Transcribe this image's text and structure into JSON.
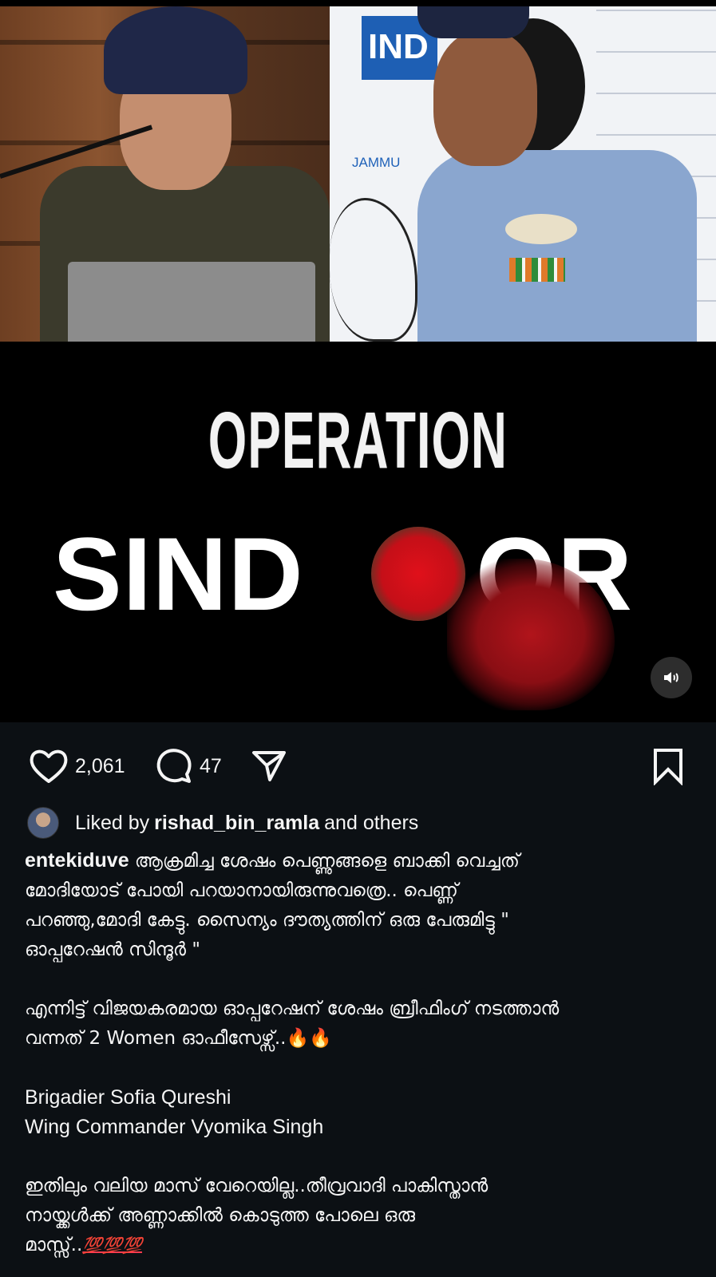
{
  "media": {
    "map_label_ind": "IND",
    "map_label_jammu": "JAMMU",
    "title_line1": "OPERATION",
    "title_sind": "SIND",
    "title_or": "OR"
  },
  "actions": {
    "likes_count": "2,061",
    "comments_count": "47"
  },
  "liked_by": {
    "prefix": "Liked by",
    "user": "rishad_bin_ramla",
    "suffix": "and others"
  },
  "caption": {
    "username": "entekiduve",
    "line1": "ആക്രമിച്ച ശേഷം പെണ്ണുങ്ങളെ ബാക്കി വെച്ചത്",
    "line2": "മോദിയോട് പോയി പറയാനായിരുന്നുവത്രെ.. പെണ്ണ്",
    "line3": "പറഞ്ഞു,മോദി കേട്ടു. സൈന്യം ദൗത്യത്തിന് ഒരു പേരുമിട്ടു \"",
    "line4": "ഓപ്പറേഷൻ സിന്ദൂർ \"",
    "line5": "എന്നിട്ട് വിജയകരമായ ഓപ്പറേഷന് ശേഷം ബ്രീഫിംഗ് നടത്താൻ",
    "line6_a": "വന്നത് 2 Women ഓഫീസേഴ്സ്..",
    "line6_emoji": "🔥🔥",
    "officer1": "Brigadier Sofia Qureshi",
    "officer2": "Wing Commander Vyomika Singh",
    "line7": "ഇതിലും വലിയ മാസ് വേറെയില്ല..തീവ്രവാദി പാകിസ്താൻ",
    "line8": "നായ്ക്കൾക്ക് അണ്ണാക്കിൽ കൊടുത്ത പോലെ ഒരു",
    "line9_a": "മാസ്സ്..",
    "line9_emoji": "💯💯💯"
  },
  "icons": [
    "heart-icon",
    "comment-icon",
    "share-icon",
    "bookmark-icon",
    "volume-icon"
  ]
}
